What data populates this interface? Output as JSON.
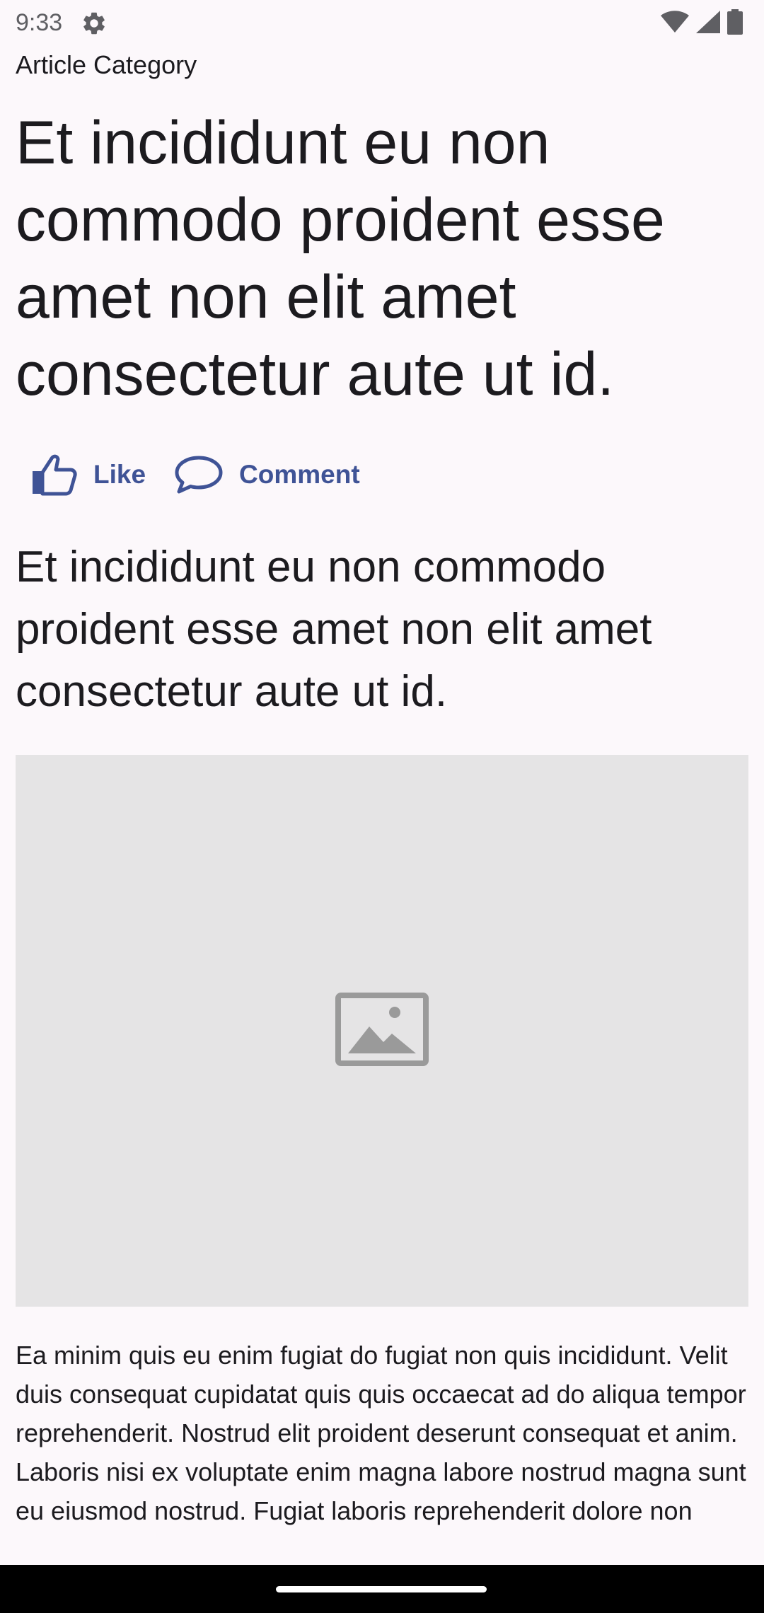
{
  "status_bar": {
    "time": "9:33",
    "icons": [
      "gear-icon",
      "wifi-icon",
      "signal-icon",
      "battery-icon"
    ]
  },
  "article": {
    "category": "Article Category",
    "headline": "Et incididunt eu non commodo proident esse amet non elit amet consectetur aute ut id.",
    "actions": {
      "like_label": "Like",
      "comment_label": "Comment"
    },
    "subheadline": "Et incididunt eu non commodo proident esse amet non elit amet consectetur aute ut id.",
    "image_icon": "image-placeholder-icon",
    "body": "Ea minim quis eu enim fugiat do fugiat non quis incididunt. Velit duis consequat cupidatat quis quis occaecat ad do aliqua tempor reprehenderit. Nostrud elit proident deserunt consequat et anim. Laboris nisi ex voluptate enim magna labore nostrud magna sunt eu eiusmod nostrud. Fugiat laboris reprehenderit dolore non"
  },
  "colors": {
    "accent": "#3f5396",
    "background": "#fcf8fb",
    "placeholder": "#e5e4e5"
  }
}
